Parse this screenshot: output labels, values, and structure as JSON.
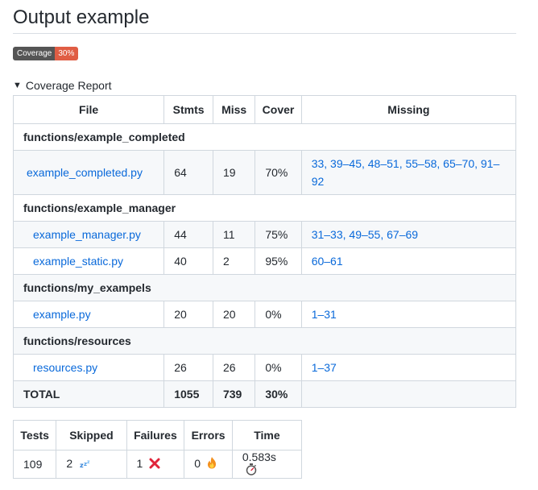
{
  "heading": "Output example",
  "badge": {
    "label": "Coverage",
    "value": "30%",
    "label_color": "#555555",
    "value_color": "#e05d44"
  },
  "report": {
    "summary": "Coverage Report",
    "headers": [
      "File",
      "Stmts",
      "Miss",
      "Cover",
      "Missing"
    ],
    "groups": [
      {
        "name": "functions/example_completed",
        "rows": [
          {
            "file": "example_completed.py",
            "stmts": "64",
            "miss": "19",
            "cover": "70%",
            "missing": "33, 39–45, 48–51, 55–58, 65–70, 91–92"
          }
        ]
      },
      {
        "name": "functions/example_manager",
        "rows": [
          {
            "file": "example_manager.py",
            "stmts": "44",
            "miss": "11",
            "cover": "75%",
            "missing": "31–33, 49–55, 67–69"
          },
          {
            "file": "example_static.py",
            "stmts": "40",
            "miss": "2",
            "cover": "95%",
            "missing": "60–61"
          }
        ]
      },
      {
        "name": "functions/my_exampels",
        "rows": [
          {
            "file": "example.py",
            "stmts": "20",
            "miss": "20",
            "cover": "0%",
            "missing": "1–31"
          }
        ]
      },
      {
        "name": "functions/resources",
        "rows": [
          {
            "file": "resources.py",
            "stmts": "26",
            "miss": "26",
            "cover": "0%",
            "missing": "1–37"
          }
        ]
      }
    ],
    "total": {
      "label": "TOTAL",
      "stmts": "1055",
      "miss": "739",
      "cover": "30%"
    }
  },
  "results": {
    "headers": [
      "Tests",
      "Skipped",
      "Failures",
      "Errors",
      "Time"
    ],
    "tests": "109",
    "skipped": "2",
    "failures": "1",
    "errors": "0",
    "time": "0.583s",
    "icons": {
      "skipped": "zzz-icon",
      "failures": "cross-mark-icon",
      "errors": "fire-icon",
      "time": "stopwatch-icon"
    }
  }
}
